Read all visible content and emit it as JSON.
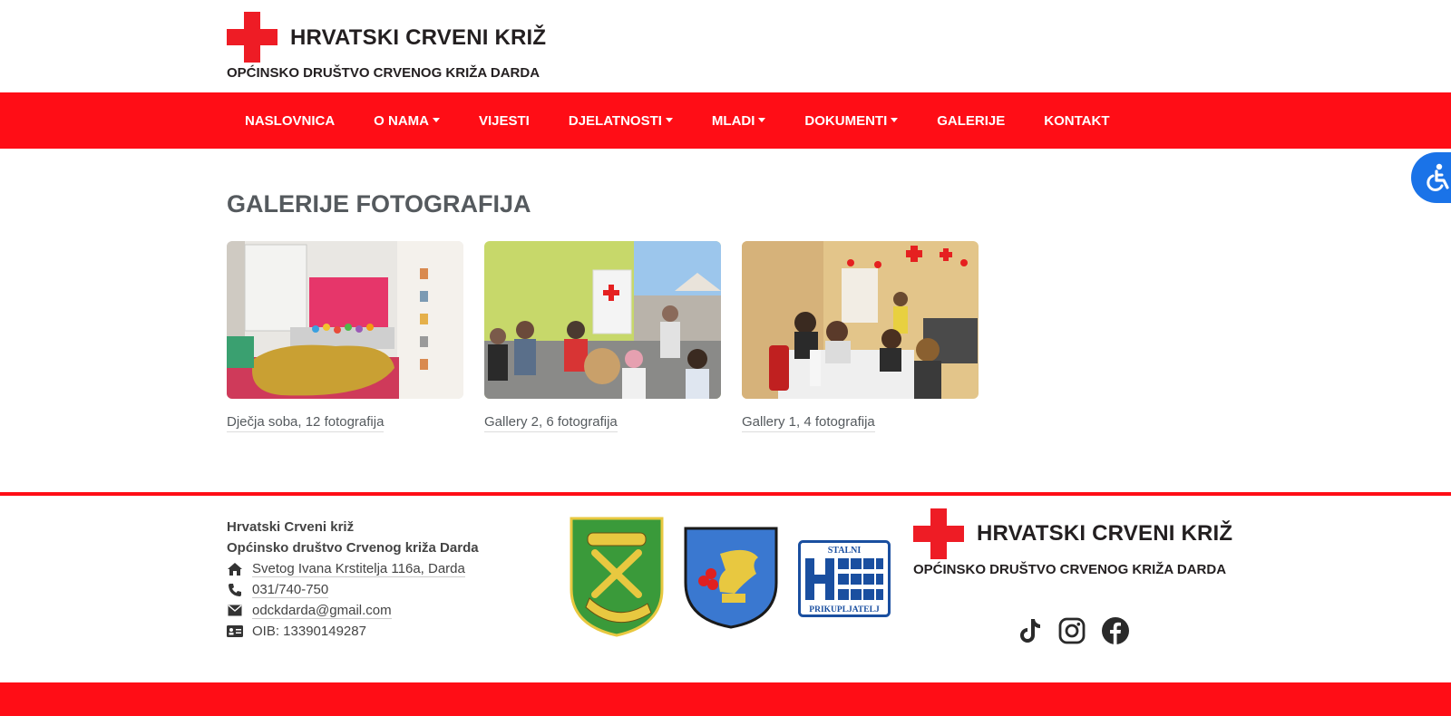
{
  "header": {
    "logo_title": "HRVATSKI CRVENI KRIŽ",
    "logo_subtitle": "OPĆINSKO DRUŠTVO CRVENOG KRIŽA DARDA"
  },
  "nav": {
    "items": [
      {
        "label": "NASLOVNICA",
        "dropdown": false
      },
      {
        "label": "O NAMA",
        "dropdown": true
      },
      {
        "label": "VIJESTI",
        "dropdown": false
      },
      {
        "label": "DJELATNOSTI",
        "dropdown": true
      },
      {
        "label": "MLADI",
        "dropdown": true
      },
      {
        "label": "DOKUMENTI",
        "dropdown": true
      },
      {
        "label": "GALERIJE",
        "dropdown": false
      },
      {
        "label": "KONTAKT",
        "dropdown": false
      }
    ]
  },
  "main": {
    "title": "GALERIJE FOTOGRAFIJA",
    "galleries": [
      {
        "caption": "Dječja soba, 12 fotografija"
      },
      {
        "caption": "Gallery 2, 6 fotografija"
      },
      {
        "caption": "Gallery 1, 4 fotografija"
      }
    ]
  },
  "footer": {
    "org_name": "Hrvatski Crveni križ",
    "org_branch": "Općinsko društvo Crvenog križa Darda",
    "address": "Svetog Ivana Krstitelja 116a, Darda",
    "phone": "031/740-750",
    "email": "odckdarda@gmail.com",
    "oib": "OIB: 13390149287",
    "badge_top": "STALNI",
    "badge_bottom": "PRIKUPLJATELJ",
    "logo_title": "HRVATSKI CRVENI KRIŽ",
    "logo_subtitle": "OPĆINSKO DRUŠTVO CRVENOG KRIŽA DARDA",
    "social": [
      "tiktok-icon",
      "instagram-icon",
      "facebook-icon"
    ]
  },
  "colors": {
    "brand_red": "#ff0d16",
    "cross_red": "#ee1c25",
    "accessibility_blue": "#1a73e8",
    "text_gray": "#555a5e"
  }
}
